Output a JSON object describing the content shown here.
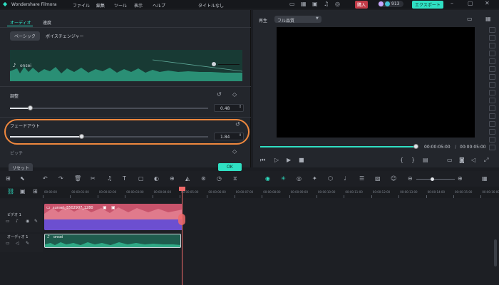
{
  "titlebar": {
    "app_name": "Wondershare Filmora",
    "menu": [
      "ファイル",
      "編集",
      "ツール",
      "表示",
      "ヘルプ"
    ],
    "project_title": "タイトルなし",
    "buy_label": "購入",
    "credits": "913",
    "export_label": "エクスポート"
  },
  "left_panel": {
    "tabs": [
      "オーディオ",
      "速度"
    ],
    "subtabs": [
      "ベーシック",
      "ボイスチェンジャー"
    ],
    "clip_name": "onsei",
    "adjust_label": "調整",
    "adjust_value": "0.48",
    "fadeout_label": "フェードアウト",
    "fadeout_value": "1.84",
    "pitch_label": "ピッチ",
    "reset_label": "リセット",
    "ok_label": "OK",
    "adjust_level": 0.1,
    "fadeout_level": 0.36
  },
  "preview": {
    "play_label": "再生",
    "quality_label": "フル品質",
    "current_time": "00:00:05:00",
    "total_time": "00:00:05:00",
    "progress": 0.98
  },
  "timeline": {
    "ruler": [
      "00:00:00",
      "00:00:01:00",
      "00:00:02:00",
      "00:00:03:00",
      "00:00:04:00",
      "00:00:05:00",
      "00:00:06:00",
      "00:00:07:00",
      "00:00:08:00",
      "00:00:09:00",
      "00:00:10:00",
      "00:00:11:00",
      "00:00:12:00",
      "00:00:13:00",
      "00:00:14:00",
      "00:00:15:00",
      "00:00:16:00"
    ],
    "video_track_label": "ビデオ 1",
    "audio_track_label": "オーディオ 1",
    "video_clip_name": "sunset_5502907_1280",
    "audio_clip_name": "onsei"
  },
  "colors": {
    "accent": "#2fe0c3",
    "highlight_ring": "#f0883e",
    "playhead": "#f06a6a",
    "video_clip": "#7b5bd6",
    "audio_clip": "#1f5c4e"
  }
}
